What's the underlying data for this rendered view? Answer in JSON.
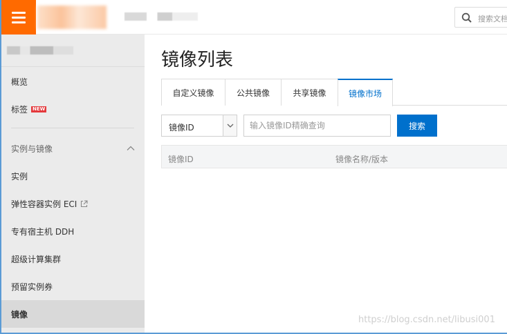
{
  "topbar": {
    "search_placeholder": "搜索文档"
  },
  "sidebar": {
    "items": [
      {
        "label": "概览"
      },
      {
        "label": "标签",
        "badge": "NEW"
      },
      {
        "label": "实例与镜像"
      },
      {
        "label": "实例"
      },
      {
        "label": "弹性容器实例 ECI"
      },
      {
        "label": "专有宿主机 DDH"
      },
      {
        "label": "超级计算集群"
      },
      {
        "label": "预留实例券"
      },
      {
        "label": "镜像"
      }
    ]
  },
  "main": {
    "title": "镜像列表",
    "tabs": [
      {
        "label": "自定义镜像"
      },
      {
        "label": "公共镜像"
      },
      {
        "label": "共享镜像"
      },
      {
        "label": "镜像市场"
      }
    ],
    "active_tab": "镜像市场",
    "filter": {
      "select_value": "镜像ID",
      "input_placeholder": "输入镜像ID精确查询",
      "search_button": "搜索"
    },
    "table": {
      "columns": [
        "镜像ID",
        "镜像名称/版本"
      ]
    }
  },
  "watermark": "https://blog.csdn.net/libusi001",
  "colors": {
    "menu_button": "#ff6a00",
    "primary": "#0070cc",
    "sidebar_bg": "#ebebeb",
    "badge": "#e4393c"
  }
}
